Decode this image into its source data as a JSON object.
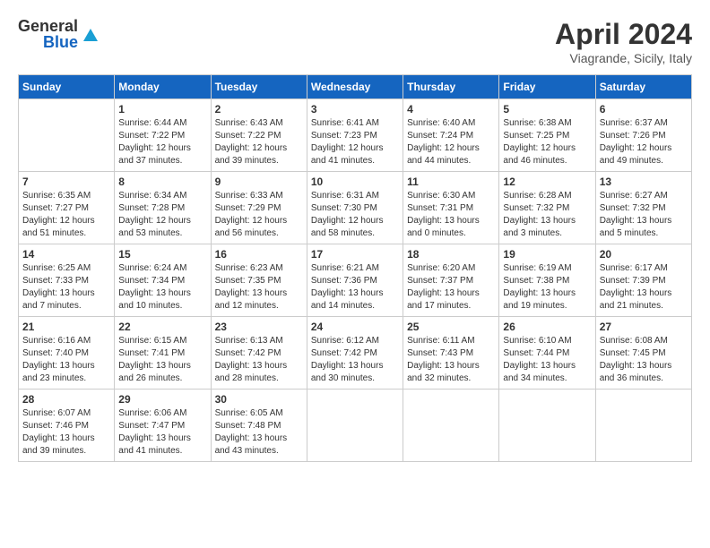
{
  "header": {
    "logo_general": "General",
    "logo_blue": "Blue",
    "month_title": "April 2024",
    "subtitle": "Viagrande, Sicily, Italy"
  },
  "days_of_week": [
    "Sunday",
    "Monday",
    "Tuesday",
    "Wednesday",
    "Thursday",
    "Friday",
    "Saturday"
  ],
  "weeks": [
    [
      {
        "day": "",
        "info": ""
      },
      {
        "day": "1",
        "info": "Sunrise: 6:44 AM\nSunset: 7:22 PM\nDaylight: 12 hours\nand 37 minutes."
      },
      {
        "day": "2",
        "info": "Sunrise: 6:43 AM\nSunset: 7:22 PM\nDaylight: 12 hours\nand 39 minutes."
      },
      {
        "day": "3",
        "info": "Sunrise: 6:41 AM\nSunset: 7:23 PM\nDaylight: 12 hours\nand 41 minutes."
      },
      {
        "day": "4",
        "info": "Sunrise: 6:40 AM\nSunset: 7:24 PM\nDaylight: 12 hours\nand 44 minutes."
      },
      {
        "day": "5",
        "info": "Sunrise: 6:38 AM\nSunset: 7:25 PM\nDaylight: 12 hours\nand 46 minutes."
      },
      {
        "day": "6",
        "info": "Sunrise: 6:37 AM\nSunset: 7:26 PM\nDaylight: 12 hours\nand 49 minutes."
      }
    ],
    [
      {
        "day": "7",
        "info": "Sunrise: 6:35 AM\nSunset: 7:27 PM\nDaylight: 12 hours\nand 51 minutes."
      },
      {
        "day": "8",
        "info": "Sunrise: 6:34 AM\nSunset: 7:28 PM\nDaylight: 12 hours\nand 53 minutes."
      },
      {
        "day": "9",
        "info": "Sunrise: 6:33 AM\nSunset: 7:29 PM\nDaylight: 12 hours\nand 56 minutes."
      },
      {
        "day": "10",
        "info": "Sunrise: 6:31 AM\nSunset: 7:30 PM\nDaylight: 12 hours\nand 58 minutes."
      },
      {
        "day": "11",
        "info": "Sunrise: 6:30 AM\nSunset: 7:31 PM\nDaylight: 13 hours\nand 0 minutes."
      },
      {
        "day": "12",
        "info": "Sunrise: 6:28 AM\nSunset: 7:32 PM\nDaylight: 13 hours\nand 3 minutes."
      },
      {
        "day": "13",
        "info": "Sunrise: 6:27 AM\nSunset: 7:32 PM\nDaylight: 13 hours\nand 5 minutes."
      }
    ],
    [
      {
        "day": "14",
        "info": "Sunrise: 6:25 AM\nSunset: 7:33 PM\nDaylight: 13 hours\nand 7 minutes."
      },
      {
        "day": "15",
        "info": "Sunrise: 6:24 AM\nSunset: 7:34 PM\nDaylight: 13 hours\nand 10 minutes."
      },
      {
        "day": "16",
        "info": "Sunrise: 6:23 AM\nSunset: 7:35 PM\nDaylight: 13 hours\nand 12 minutes."
      },
      {
        "day": "17",
        "info": "Sunrise: 6:21 AM\nSunset: 7:36 PM\nDaylight: 13 hours\nand 14 minutes."
      },
      {
        "day": "18",
        "info": "Sunrise: 6:20 AM\nSunset: 7:37 PM\nDaylight: 13 hours\nand 17 minutes."
      },
      {
        "day": "19",
        "info": "Sunrise: 6:19 AM\nSunset: 7:38 PM\nDaylight: 13 hours\nand 19 minutes."
      },
      {
        "day": "20",
        "info": "Sunrise: 6:17 AM\nSunset: 7:39 PM\nDaylight: 13 hours\nand 21 minutes."
      }
    ],
    [
      {
        "day": "21",
        "info": "Sunrise: 6:16 AM\nSunset: 7:40 PM\nDaylight: 13 hours\nand 23 minutes."
      },
      {
        "day": "22",
        "info": "Sunrise: 6:15 AM\nSunset: 7:41 PM\nDaylight: 13 hours\nand 26 minutes."
      },
      {
        "day": "23",
        "info": "Sunrise: 6:13 AM\nSunset: 7:42 PM\nDaylight: 13 hours\nand 28 minutes."
      },
      {
        "day": "24",
        "info": "Sunrise: 6:12 AM\nSunset: 7:42 PM\nDaylight: 13 hours\nand 30 minutes."
      },
      {
        "day": "25",
        "info": "Sunrise: 6:11 AM\nSunset: 7:43 PM\nDaylight: 13 hours\nand 32 minutes."
      },
      {
        "day": "26",
        "info": "Sunrise: 6:10 AM\nSunset: 7:44 PM\nDaylight: 13 hours\nand 34 minutes."
      },
      {
        "day": "27",
        "info": "Sunrise: 6:08 AM\nSunset: 7:45 PM\nDaylight: 13 hours\nand 36 minutes."
      }
    ],
    [
      {
        "day": "28",
        "info": "Sunrise: 6:07 AM\nSunset: 7:46 PM\nDaylight: 13 hours\nand 39 minutes."
      },
      {
        "day": "29",
        "info": "Sunrise: 6:06 AM\nSunset: 7:47 PM\nDaylight: 13 hours\nand 41 minutes."
      },
      {
        "day": "30",
        "info": "Sunrise: 6:05 AM\nSunset: 7:48 PM\nDaylight: 13 hours\nand 43 minutes."
      },
      {
        "day": "",
        "info": ""
      },
      {
        "day": "",
        "info": ""
      },
      {
        "day": "",
        "info": ""
      },
      {
        "day": "",
        "info": ""
      }
    ]
  ]
}
